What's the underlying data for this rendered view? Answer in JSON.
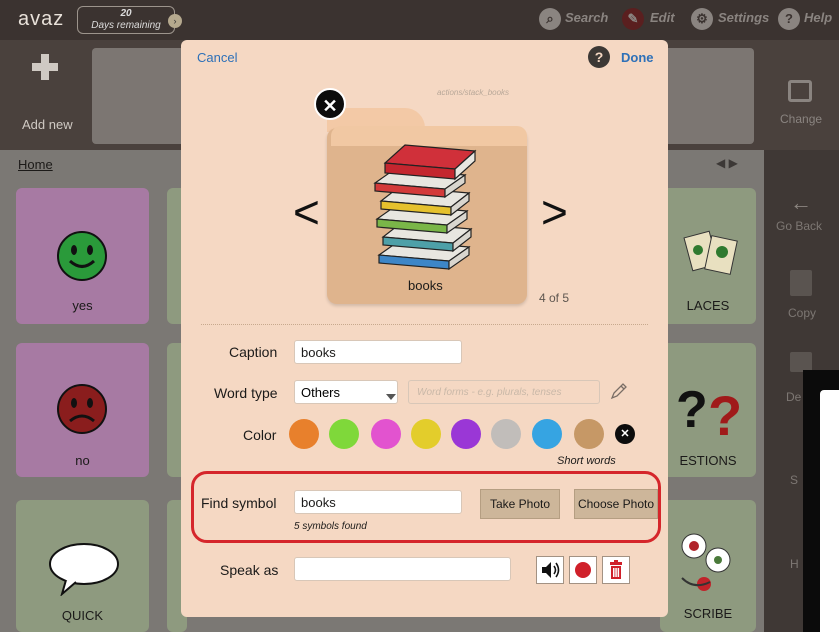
{
  "topbar": {
    "logo": "avaz",
    "days_number": "20",
    "days_text": "Days remaining",
    "search_label": "Search",
    "edit_label": "Edit",
    "settings_label": "Settings",
    "help_label": "Help"
  },
  "toolbar": {
    "add_new_label": "Add new",
    "change_label": "Change"
  },
  "board": {
    "breadcrumb": "Home",
    "tiles": [
      {
        "label": "yes",
        "icon": "smiley-face-icon"
      },
      {
        "label": "LACES",
        "icon": "places-icon"
      },
      {
        "label": "no",
        "icon": "sad-face-icon"
      },
      {
        "label": "ESTIONS",
        "icon": "question-marks-icon"
      },
      {
        "label": "QUICK",
        "icon": "speech-bubble-icon"
      },
      {
        "label": "SCRIBE",
        "icon": "describe-icon"
      }
    ]
  },
  "sidebar": {
    "go_back": "Go Back",
    "copy": "Copy",
    "de": "De",
    "s": "S",
    "h": "H"
  },
  "modal": {
    "cancel": "Cancel",
    "done": "Done",
    "path": "actions/stack_books",
    "symbol_caption": "books",
    "count": "4 of 5",
    "caption_label": "Caption",
    "caption_value": "books",
    "word_type_label": "Word type",
    "word_type_value": "Others",
    "word_forms_placeholder": "Word forms - e.g. plurals, tenses",
    "color_label": "Color",
    "colors": [
      "#e8802c",
      "#7fd83a",
      "#e253cf",
      "#e3cd2b",
      "#9a37d6",
      "#c1bdba",
      "#36a4e2",
      "#c69866"
    ],
    "short_words": "Short words",
    "find_symbol_label": "Find symbol",
    "find_symbol_value": "books",
    "take_photo": "Take Photo",
    "choose_photo": "Choose Photo",
    "symbols_found": "5 symbols found",
    "speak_as_label": "Speak as",
    "speak_as_value": ""
  }
}
